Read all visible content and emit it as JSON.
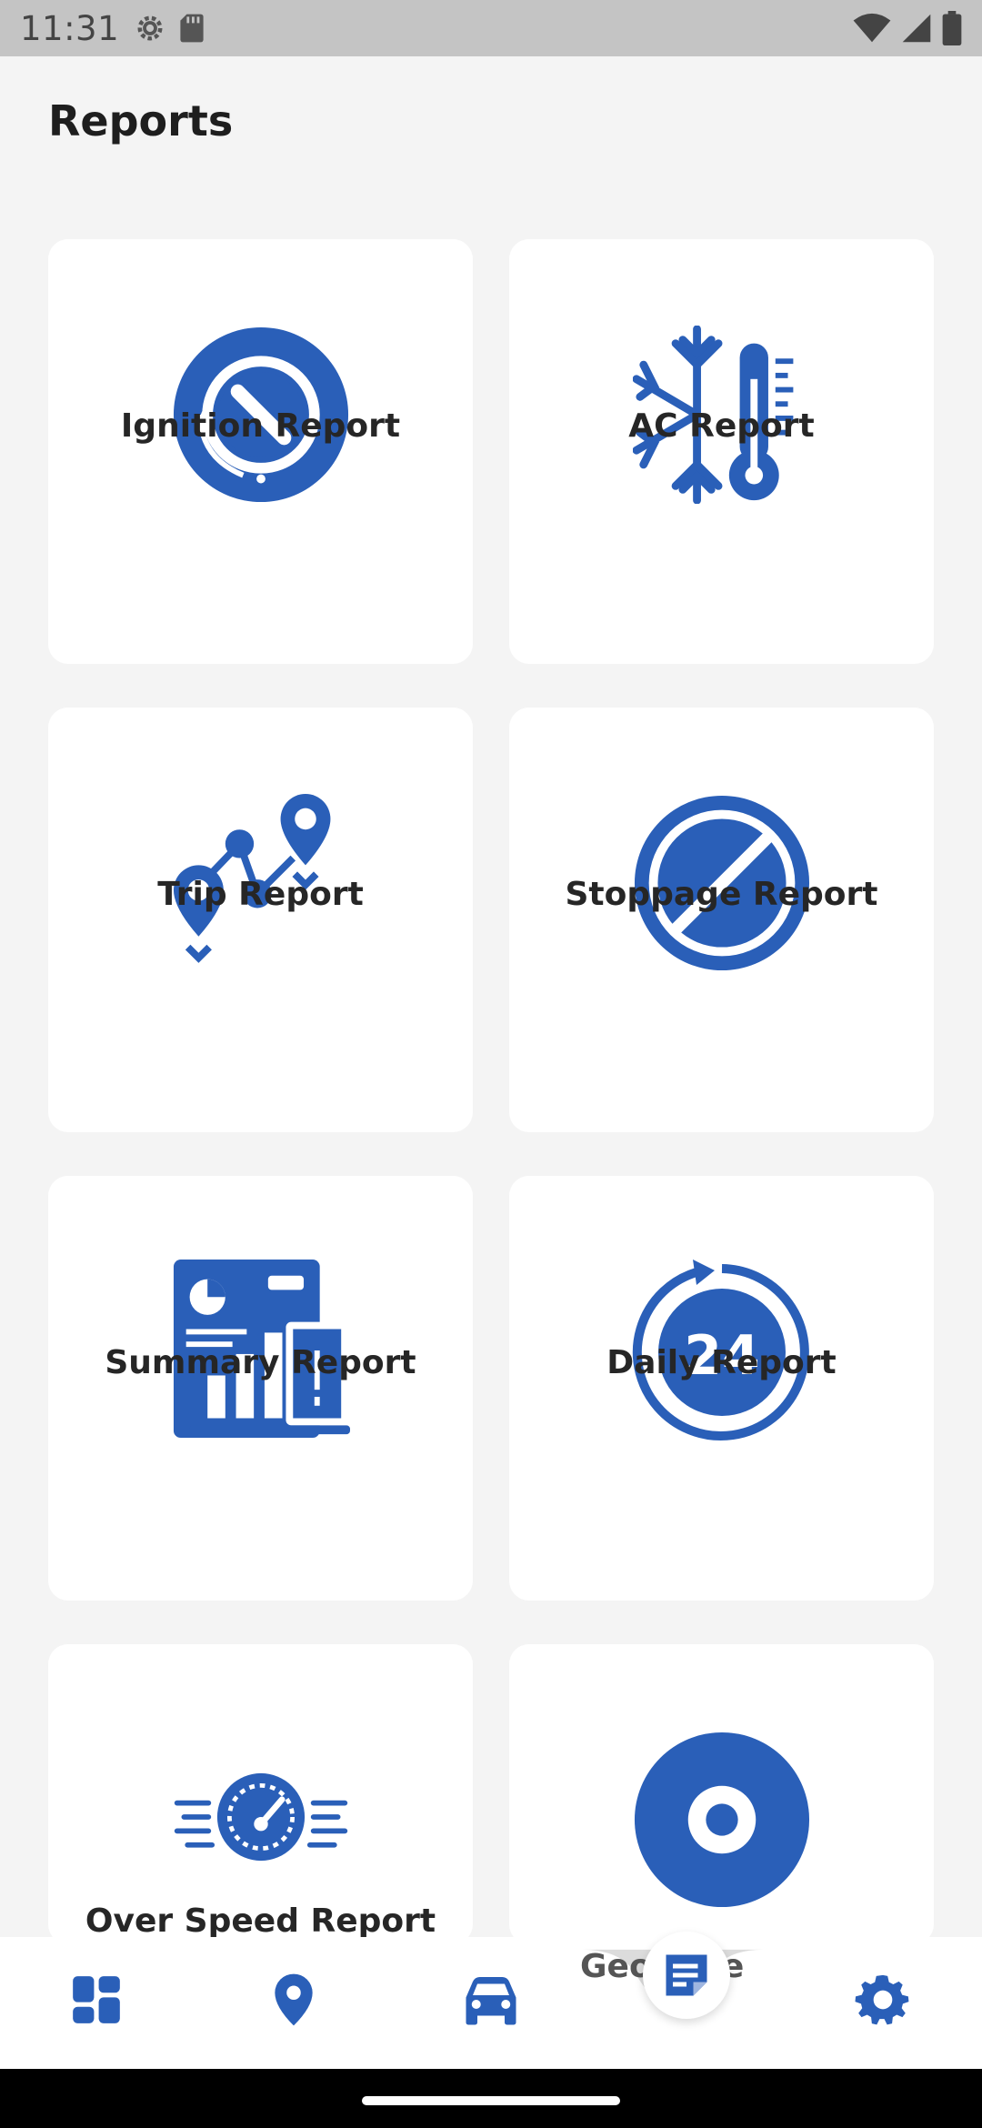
{
  "status_bar": {
    "time": "11:31"
  },
  "page": {
    "title": "Reports"
  },
  "reports": [
    {
      "label": "Ignition Report",
      "icon": "ignition-icon"
    },
    {
      "label": "AC Report",
      "icon": "snowflake-thermometer-icon"
    },
    {
      "label": "Trip Report",
      "icon": "route-pins-icon"
    },
    {
      "label": "Stoppage Report",
      "icon": "no-entry-icon"
    },
    {
      "label": "Summary Report",
      "icon": "summary-dashboard-icon"
    },
    {
      "label": "Daily Report",
      "icon": "24-hours-icon"
    },
    {
      "label": "Over Speed Report",
      "icon": "speedometer-icon"
    },
    {
      "label": "Geofence Report",
      "visible_label": "Geo   e Re",
      "icon": "geofence-ring-icon"
    }
  ],
  "bottom_nav": {
    "items": [
      "dashboard-icon",
      "location-pin-icon",
      "car-icon",
      "reports-icon",
      "settings-icon"
    ],
    "active": "reports-icon"
  },
  "colors": {
    "accent": "#2a5fb8",
    "card": "#ffffff",
    "background": "#f4f4f4"
  }
}
